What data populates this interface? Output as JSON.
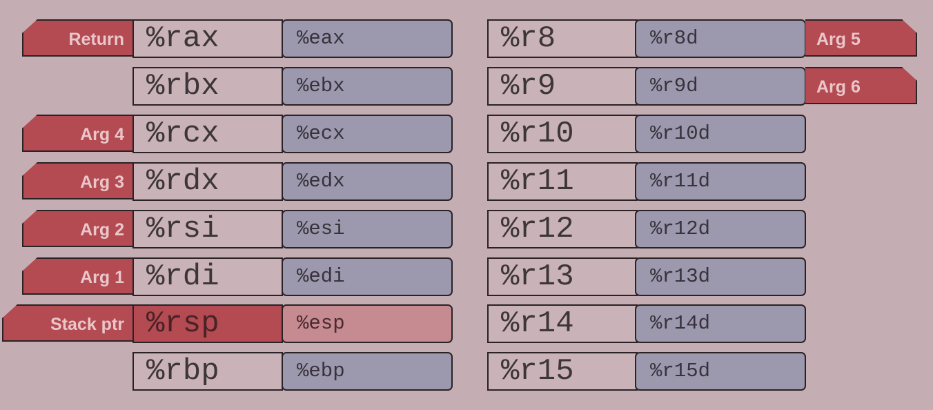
{
  "colors": {
    "background": "#c4aeb4",
    "argument_tag": "#b44a52",
    "register_64": "#c9b2b8",
    "register_32": "#9c98ad",
    "stack_register": "#b44a52",
    "stack_register_32": "#c68a91"
  },
  "left_registers": [
    {
      "reg64": "%rax",
      "reg32": "%eax",
      "role": "Return"
    },
    {
      "reg64": "%rbx",
      "reg32": "%ebx",
      "role": ""
    },
    {
      "reg64": "%rcx",
      "reg32": "%ecx",
      "role": "Arg 4"
    },
    {
      "reg64": "%rdx",
      "reg32": "%edx",
      "role": "Arg 3"
    },
    {
      "reg64": "%rsi",
      "reg32": "%esi",
      "role": "Arg 2"
    },
    {
      "reg64": "%rdi",
      "reg32": "%edi",
      "role": "Arg 1"
    },
    {
      "reg64": "%rsp",
      "reg32": "%esp",
      "role": "Stack ptr",
      "highlight": true
    },
    {
      "reg64": "%rbp",
      "reg32": "%ebp",
      "role": ""
    }
  ],
  "right_registers": [
    {
      "reg64": "%r8",
      "reg32": "%r8d",
      "role": "Arg 5"
    },
    {
      "reg64": "%r9",
      "reg32": "%r9d",
      "role": "Arg 6"
    },
    {
      "reg64": "%r10",
      "reg32": "%r10d",
      "role": ""
    },
    {
      "reg64": "%r11",
      "reg32": "%r11d",
      "role": ""
    },
    {
      "reg64": "%r12",
      "reg32": "%r12d",
      "role": ""
    },
    {
      "reg64": "%r13",
      "reg32": "%r13d",
      "role": ""
    },
    {
      "reg64": "%r14",
      "reg32": "%r14d",
      "role": ""
    },
    {
      "reg64": "%r15",
      "reg32": "%r15d",
      "role": ""
    }
  ]
}
